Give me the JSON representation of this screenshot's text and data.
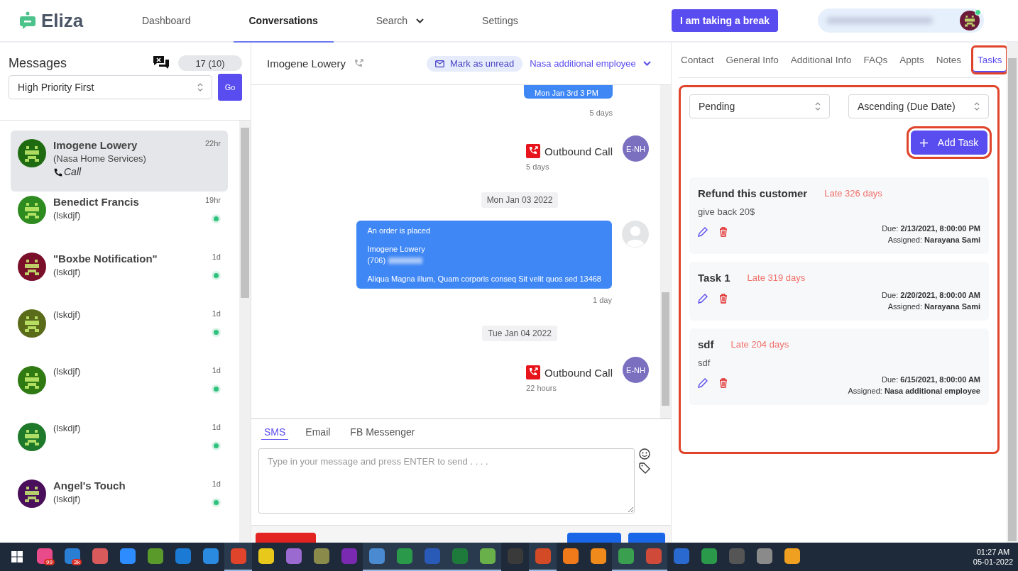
{
  "nav": {
    "logo": "Eliza",
    "items": [
      {
        "label": "Dashboard",
        "selected": false,
        "dropdown": false
      },
      {
        "label": "Conversations",
        "selected": true,
        "dropdown": false
      },
      {
        "label": "Search",
        "selected": false,
        "dropdown": true
      },
      {
        "label": "Settings",
        "selected": false,
        "dropdown": false
      }
    ],
    "break_button": "I am taking a break",
    "user": {
      "online": true,
      "color": "#6b1a3a"
    }
  },
  "messages": {
    "title": "Messages",
    "count": "17 (10)",
    "sort": "High Priority First",
    "go": "Go",
    "conversations": [
      {
        "name": "Imogene Lowery",
        "subtitle": "(Nasa Home Services)",
        "channel": "Call",
        "time": "22hr",
        "selected": true,
        "online": false,
        "color": "#1f6b12"
      },
      {
        "name": "Benedict Francis",
        "subtitle": "(lskdjf)",
        "time": "19hr",
        "selected": false,
        "online": true,
        "color": "#2e8b1f"
      },
      {
        "name": "\"Boxbe Notification\"",
        "subtitle": "(lskdjf)",
        "time": "1d",
        "selected": false,
        "online": true,
        "color": "#7a0f2a"
      },
      {
        "subtitle": "(lskdjf)",
        "time": "1d",
        "selected": false,
        "online": true,
        "color": "#5a6b1a"
      },
      {
        "subtitle": "(lskdjf)",
        "time": "1d",
        "selected": false,
        "online": true,
        "color": "#2f7a12"
      },
      {
        "subtitle": "(lskdjf)",
        "time": "1d",
        "selected": false,
        "online": true,
        "color": "#1e7a2a"
      },
      {
        "name": "Angel's Touch",
        "subtitle": "(lskdjf)",
        "time": "1d",
        "selected": false,
        "online": true,
        "color": "#4a0f5a"
      }
    ]
  },
  "chat": {
    "contact": "Imogene Lowery",
    "mark_unread": "Mark as unread",
    "agent": "Nasa additional employee",
    "thread": [
      {
        "kind": "bubble_cut",
        "lines": [
          {
            "text": "Mon Jan 3rd 3 PM"
          }
        ],
        "time": "5 days"
      },
      {
        "kind": "call",
        "label": "Outbound Call",
        "initials": "E-NH",
        "time": "5 days"
      },
      {
        "kind": "date",
        "label": "Mon Jan 03 2022"
      },
      {
        "kind": "bubble",
        "paragraphs": [
          [
            {
              "text": "An order is placed"
            }
          ],
          [
            {
              "text": "Imogene Lowery"
            },
            {
              "text": "(706)",
              "redacted": true
            }
          ],
          [
            {
              "text": "Aliqua Magna illum, Quam corporis conseq Sit velit quos sed 13468"
            }
          ]
        ],
        "time": "1 day"
      },
      {
        "kind": "date",
        "label": "Tue Jan 04 2022"
      },
      {
        "kind": "call",
        "label": "Outbound Call",
        "initials": "E-NH",
        "time": "22 hours"
      }
    ],
    "composer": {
      "tabs": [
        {
          "label": "SMS",
          "selected": true
        },
        {
          "label": "Email",
          "selected": false
        },
        {
          "label": "FB Messenger",
          "selected": false
        }
      ],
      "placeholder": "Type in your message and press ENTER to send . . . ."
    }
  },
  "details": {
    "tabs": [
      {
        "label": "Contact",
        "selected": false,
        "highlighted": false
      },
      {
        "label": "General Info",
        "selected": false,
        "highlighted": false
      },
      {
        "label": "Additional Info",
        "selected": false,
        "highlighted": false
      },
      {
        "label": "FAQs",
        "selected": false,
        "highlighted": false
      },
      {
        "label": "Appts",
        "selected": false,
        "highlighted": false
      },
      {
        "label": "Notes",
        "selected": false,
        "highlighted": false
      },
      {
        "label": "Tasks",
        "selected": true,
        "highlighted": true
      }
    ],
    "tasks_highlighted": true,
    "filters": [
      "Pending",
      "Ascending (Due Date)"
    ],
    "add_task": {
      "label": "Add Task",
      "highlighted": true
    },
    "tasks": [
      {
        "title": "Refund this customer",
        "status": "Late 326 days",
        "description": "give back 20$",
        "due": "Due: **2/13/2021, 8:00:00 PM**",
        "assigned": "Assigned: **Narayana Sami**"
      },
      {
        "title": "Task 1",
        "status": "Late 319 days",
        "due": "Due: **2/20/2021, 8:00:00 AM**",
        "assigned": "Assigned: **Narayana Sami**"
      },
      {
        "title": "sdf",
        "status": "Late 204 days",
        "description": "sdf",
        "due": "Due: **6/15/2021, 8:00:00 AM**",
        "assigned": "Assigned: **Nasa additional employee**"
      }
    ]
  },
  "taskbar": {
    "apps": [
      {
        "color": "#e84a8a",
        "badge": "99",
        "running": false
      },
      {
        "color": "#2a7fd4",
        "badge": "3k",
        "running": false
      },
      {
        "color": "#d85a5a",
        "running": false
      },
      {
        "color": "#2d8cff",
        "running": false
      },
      {
        "color": "#5a9a2a",
        "running": false
      },
      {
        "color": "#1a7ad4",
        "running": false
      },
      {
        "color": "#2a8ae0",
        "running": false
      },
      {
        "color": "#e0442a",
        "running": true
      },
      {
        "color": "#e8c81a",
        "running": false
      },
      {
        "color": "#9a6ad0",
        "running": false
      },
      {
        "color": "#8a8a4a",
        "running": false
      },
      {
        "color": "#7a2ab0",
        "running": false
      },
      {
        "color": "#4a8ad0",
        "running": true
      },
      {
        "color": "#2a9a4a",
        "running": true
      },
      {
        "color": "#2a5ab8",
        "running": true
      },
      {
        "color": "#1e7a3a",
        "running": true
      },
      {
        "color": "#6ab04a",
        "running": true
      },
      {
        "color": "#3a3a3a",
        "running": false
      },
      {
        "color": "#d24a26",
        "running": true
      },
      {
        "color": "#f07a1a",
        "running": false
      },
      {
        "color": "#f08a1a",
        "running": false
      },
      {
        "color": "#3aa050",
        "running": true
      },
      {
        "color": "#d04a3a",
        "running": true
      },
      {
        "color": "#2a6ad0",
        "running": false
      },
      {
        "color": "#2a9a4a",
        "running": false
      },
      {
        "color": "#555555",
        "running": false
      },
      {
        "color": "#8a8a8a",
        "running": false
      },
      {
        "color": "#f0a020",
        "running": false
      }
    ],
    "time": "01:27 AM",
    "date": "05-01-2022"
  }
}
